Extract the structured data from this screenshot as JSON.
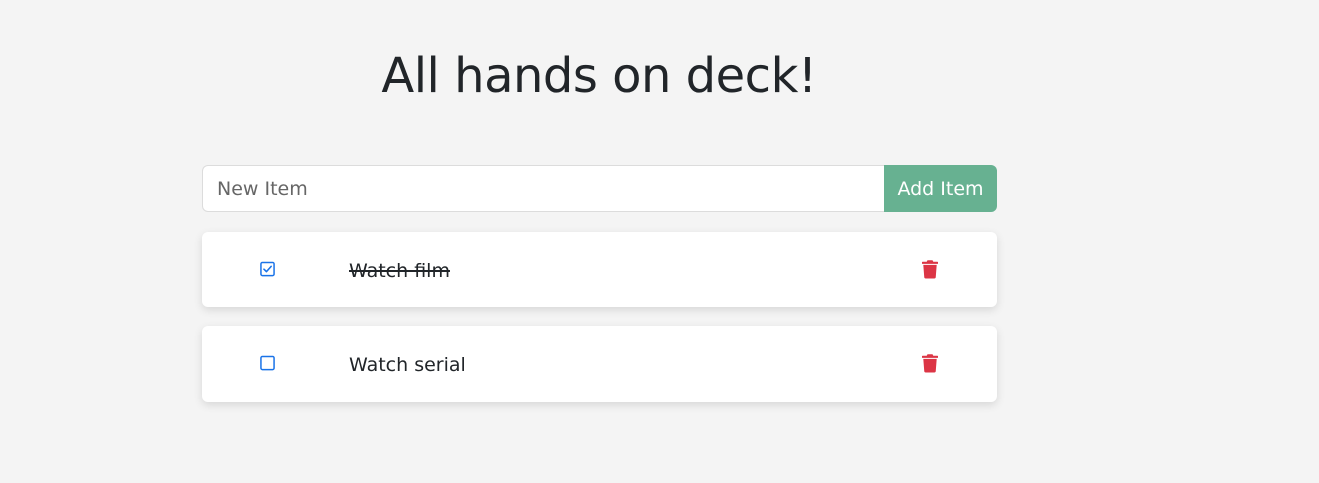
{
  "header": {
    "title": "All hands on deck!"
  },
  "input": {
    "placeholder": "New Item",
    "value": ""
  },
  "add_button": {
    "label": "Add Item",
    "color": "#67b191"
  },
  "items": [
    {
      "text": "Watch film",
      "completed": true
    },
    {
      "text": "Watch serial",
      "completed": false
    }
  ],
  "colors": {
    "background": "#f4f4f4",
    "checkbox": "#1a73e8",
    "trash": "#dc3545"
  },
  "icons": {
    "checkbox": "checkbox-icon",
    "delete": "trash-icon"
  }
}
